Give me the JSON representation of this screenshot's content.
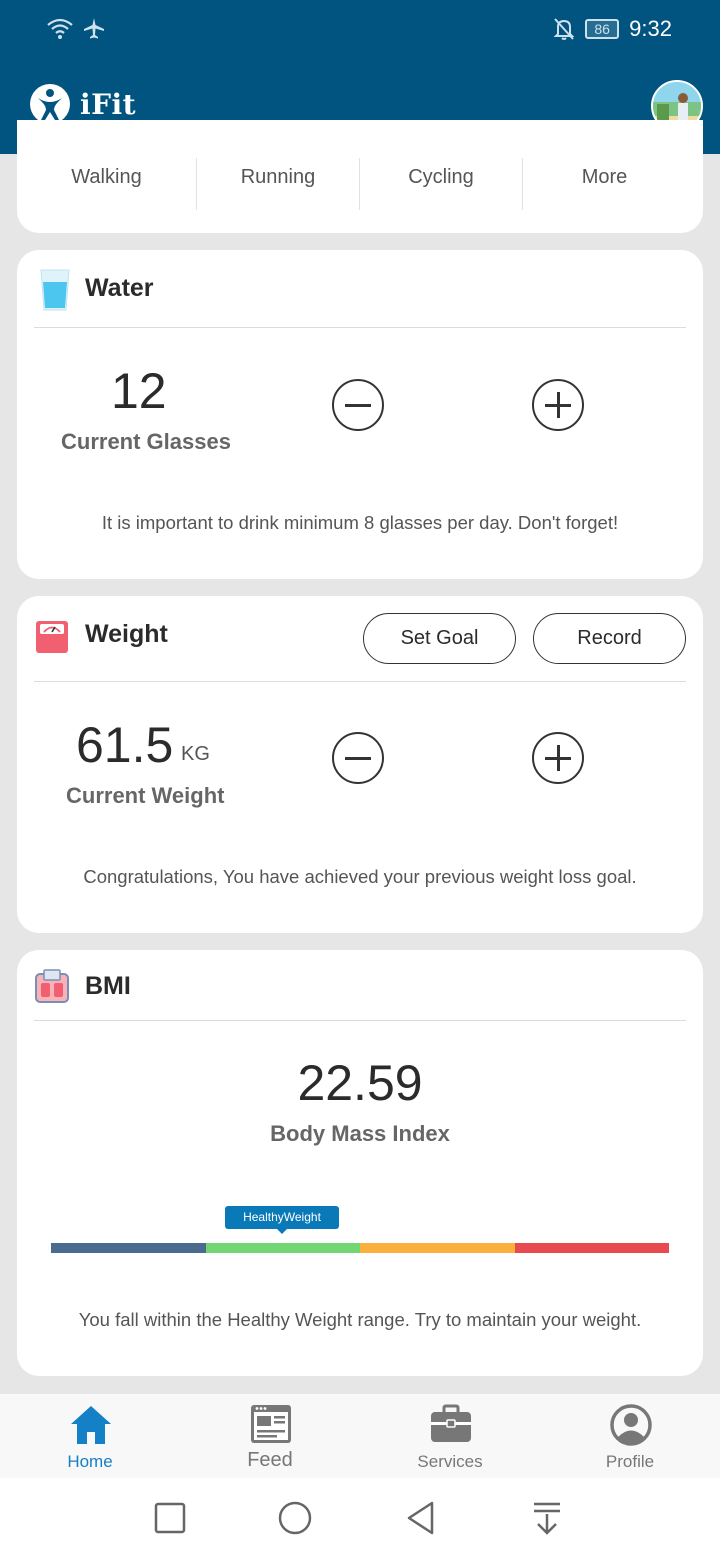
{
  "status_bar": {
    "battery": "86",
    "time": "9:32"
  },
  "app_bar": {
    "app_name": "iFit"
  },
  "activities": {
    "items": [
      {
        "label": "Walking"
      },
      {
        "label": "Running"
      },
      {
        "label": "Cycling"
      },
      {
        "label": "More"
      }
    ]
  },
  "water": {
    "title": "Water",
    "count": "12",
    "count_label": "Current Glasses",
    "note": "It is important to drink minimum 8 glasses per day. Don't forget!"
  },
  "weight": {
    "title": "Weight",
    "set_goal_label": "Set Goal",
    "record_label": "Record",
    "value": "61.5",
    "unit": "KG",
    "value_label": "Current Weight",
    "note": "Congratulations, You have achieved your previous weight loss goal."
  },
  "bmi": {
    "title": "BMI",
    "value": "22.59",
    "value_label": "Body Mass Index",
    "tag": "HealthyWeight",
    "scale_colors": [
      "#4a6a8f",
      "#72d672",
      "#fbb03b",
      "#e84a4f"
    ],
    "note": "You fall within the Healthy Weight range. Try to maintain your weight."
  },
  "bottom_nav": {
    "items": [
      {
        "label": "Home",
        "icon": "home-icon",
        "active": true
      },
      {
        "label": "Feed",
        "icon": "feed-icon",
        "active": false
      },
      {
        "label": "Services",
        "icon": "briefcase-icon",
        "active": false
      },
      {
        "label": "Profile",
        "icon": "profile-icon",
        "active": false
      }
    ]
  },
  "colors": {
    "primary": "#015480",
    "accent": "#1480c6"
  }
}
